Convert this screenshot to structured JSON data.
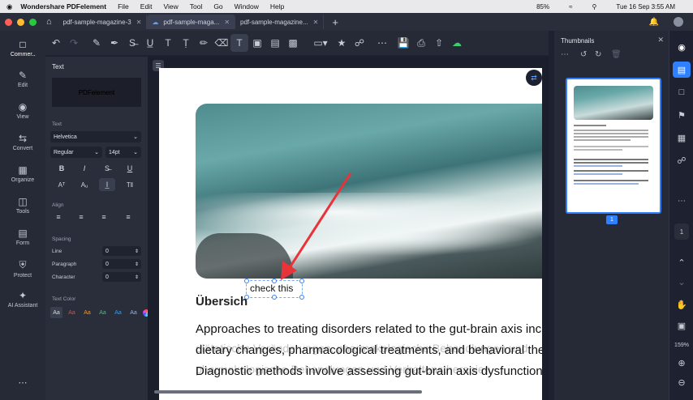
{
  "menubar": {
    "app": "Wondershare PDFelement",
    "items": [
      "File",
      "Edit",
      "View",
      "Tool",
      "Go",
      "Window",
      "Help"
    ],
    "battery": "85%",
    "datetime": "Tue 16 Sep  3:55 AM"
  },
  "tabs": [
    {
      "label": "pdf-sample-magazine-3",
      "active": false
    },
    {
      "label": "pdf-sample-maga...",
      "active": true
    },
    {
      "label": "pdf-sample-magazine...",
      "active": false
    }
  ],
  "rail": [
    {
      "label": "Comment",
      "icon": "comment-icon",
      "active": true
    },
    {
      "label": "Edit",
      "icon": "edit-icon"
    },
    {
      "label": "View",
      "icon": "view-icon"
    },
    {
      "label": "Convert",
      "icon": "convert-icon"
    },
    {
      "label": "Organize",
      "icon": "organize-icon"
    },
    {
      "label": "Tools",
      "icon": "tools-icon"
    },
    {
      "label": "Form",
      "icon": "form-icon"
    },
    {
      "label": "Protect",
      "icon": "protect-icon"
    },
    {
      "label": "AI Assistant",
      "icon": "ai-icon"
    }
  ],
  "panel": {
    "title": "Text",
    "preview": "PDFelement",
    "text_label": "Text",
    "font": "Helvetica",
    "style": "Regular",
    "size": "14pt",
    "align_label": "Align",
    "spacing_label": "Spacing",
    "line_label": "Line",
    "line_value": "0",
    "paragraph_label": "Paragraph",
    "paragraph_value": "0",
    "character_label": "Character",
    "character_value": "0",
    "color_label": "Text Color",
    "color_sample": "Aa",
    "swatches": [
      "#d8dbe3",
      "#e0503c",
      "#e89a3c",
      "#3cc47a",
      "#3a9bea",
      "#8ab4f0"
    ]
  },
  "page": {
    "textbox": "check this",
    "heading": "Übersich",
    "lines": [
      "Approaches to treating disorders related to the gut-brain axis inc",
      "dietary changes, pharmacological treatments, and behavioral the",
      "Diagnostic methods involve assessing gut-brain axis dysfunction"
    ],
    "ghost_lines": [
      "diätetische Veränderungen, pharmakologische Behandlungen und",
      "pharmakologische Behandlungen und Verhaltenstherapien."
    ]
  },
  "thumbs": {
    "title": "Thumbnails",
    "page_number": "1"
  },
  "rrail": {
    "page": "1",
    "zoom": "159%"
  },
  "colors": {
    "accent": "#2f80ff",
    "arrow": "#e8333a"
  }
}
